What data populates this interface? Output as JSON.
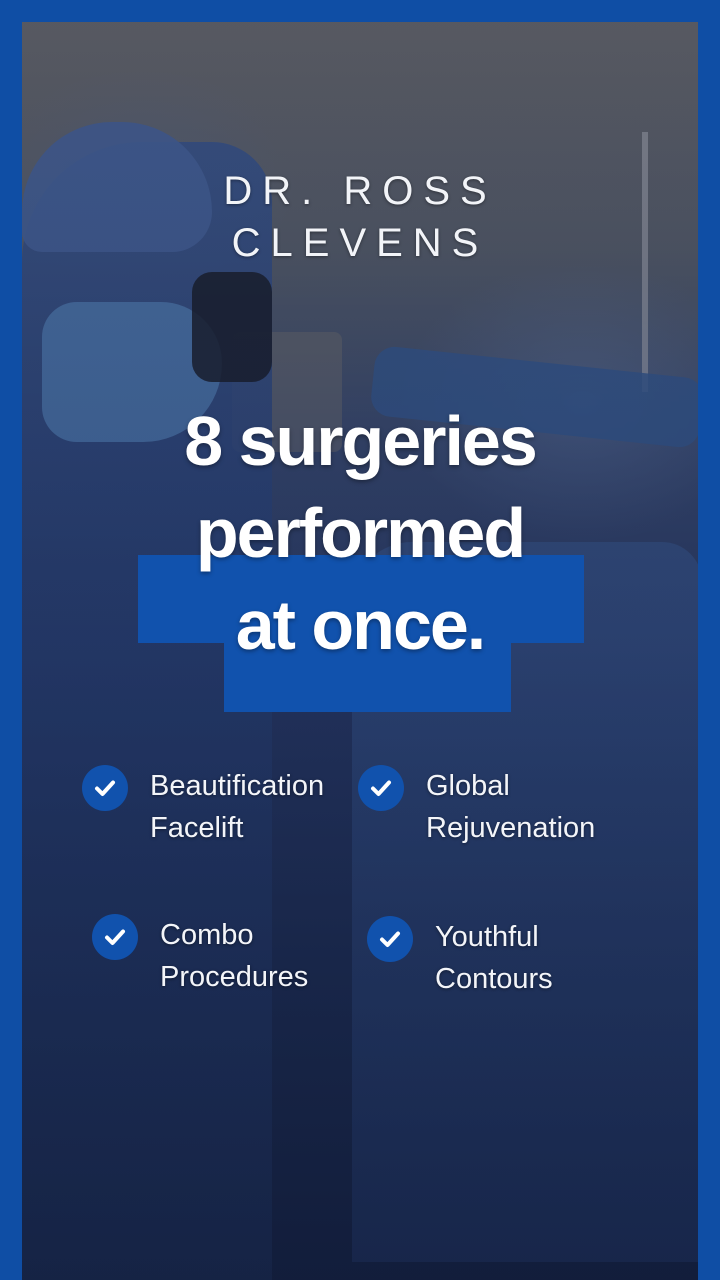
{
  "colors": {
    "frame": "#0f4ea5",
    "highlight": "#1152ad",
    "text": "#ffffff"
  },
  "brand": {
    "line1": "DR. ROSS",
    "line2": "CLEVENS"
  },
  "headline": {
    "line1": "8 surgeries",
    "line2": "performed",
    "line3": "at once."
  },
  "checklist": [
    {
      "line1": "Beautification",
      "line2": "Facelift",
      "icon": "checkmark-circle-icon"
    },
    {
      "line1": "Global",
      "line2": "Rejuvenation",
      "icon": "checkmark-circle-icon"
    },
    {
      "line1": "Combo",
      "line2": "Procedures",
      "icon": "checkmark-circle-icon"
    },
    {
      "line1": "Youthful",
      "line2": "Contours",
      "icon": "checkmark-circle-icon"
    }
  ]
}
